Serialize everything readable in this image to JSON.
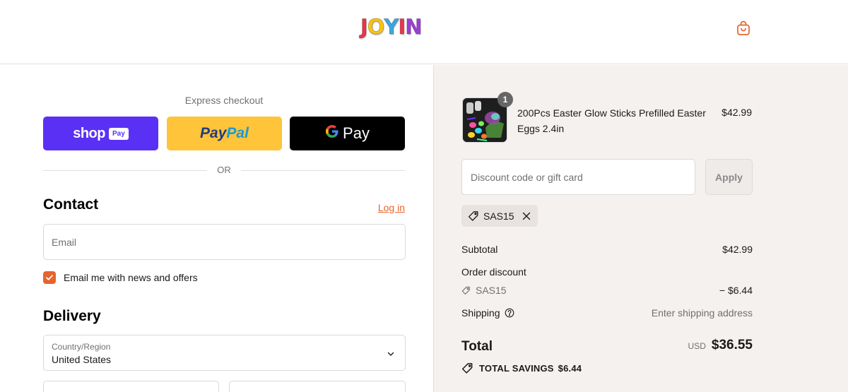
{
  "brand": {
    "logo_text": "JOYIN",
    "logo_letters": [
      "J",
      "O",
      "Y",
      "I",
      "N"
    ],
    "logo_colors": [
      "#e8354b",
      "#f7c316",
      "#3aa8e0",
      "#e8354b",
      "#9b3fd6"
    ]
  },
  "header": {
    "cart_icon": "shopping-bag-icon"
  },
  "express": {
    "title": "Express checkout",
    "shop_pay": {
      "word": "shop",
      "tag": "Pay",
      "color": "#5a31f4"
    },
    "paypal": {
      "part1": "Pay",
      "part2": "Pal",
      "color": "#ffc439"
    },
    "gpay": {
      "g": "G",
      "word": "Pay"
    },
    "or_label": "OR"
  },
  "contact": {
    "title": "Contact",
    "login_label": "Log in",
    "email_placeholder": "Email",
    "newsletter_label": "Email me with news and offers",
    "newsletter_checked": true
  },
  "delivery": {
    "title": "Delivery",
    "country_label": "Country/Region",
    "country_value": "United States"
  },
  "summary": {
    "product": {
      "name": "200Pcs Easter Glow Sticks Prefilled Easter Eggs 2.4in",
      "price": "$42.99",
      "quantity": "1"
    },
    "discount_placeholder": "Discount code or gift card",
    "apply_label": "Apply",
    "applied_code": "SAS15",
    "subtotal_label": "Subtotal",
    "subtotal_value": "$42.99",
    "order_discount_label": "Order discount",
    "discount_code": "SAS15",
    "discount_value": "− $6.44",
    "shipping_label": "Shipping",
    "shipping_value": "Enter shipping address",
    "total_label": "Total",
    "currency": "USD",
    "total_value": "$36.55",
    "savings_label": "TOTAL SAVINGS",
    "savings_value": "$6.44"
  },
  "colors": {
    "accent": "#e5652e",
    "summary_bg": "#f5f1ef",
    "paypal_blue_dark": "#253b80",
    "paypal_blue_light": "#179bd7"
  }
}
